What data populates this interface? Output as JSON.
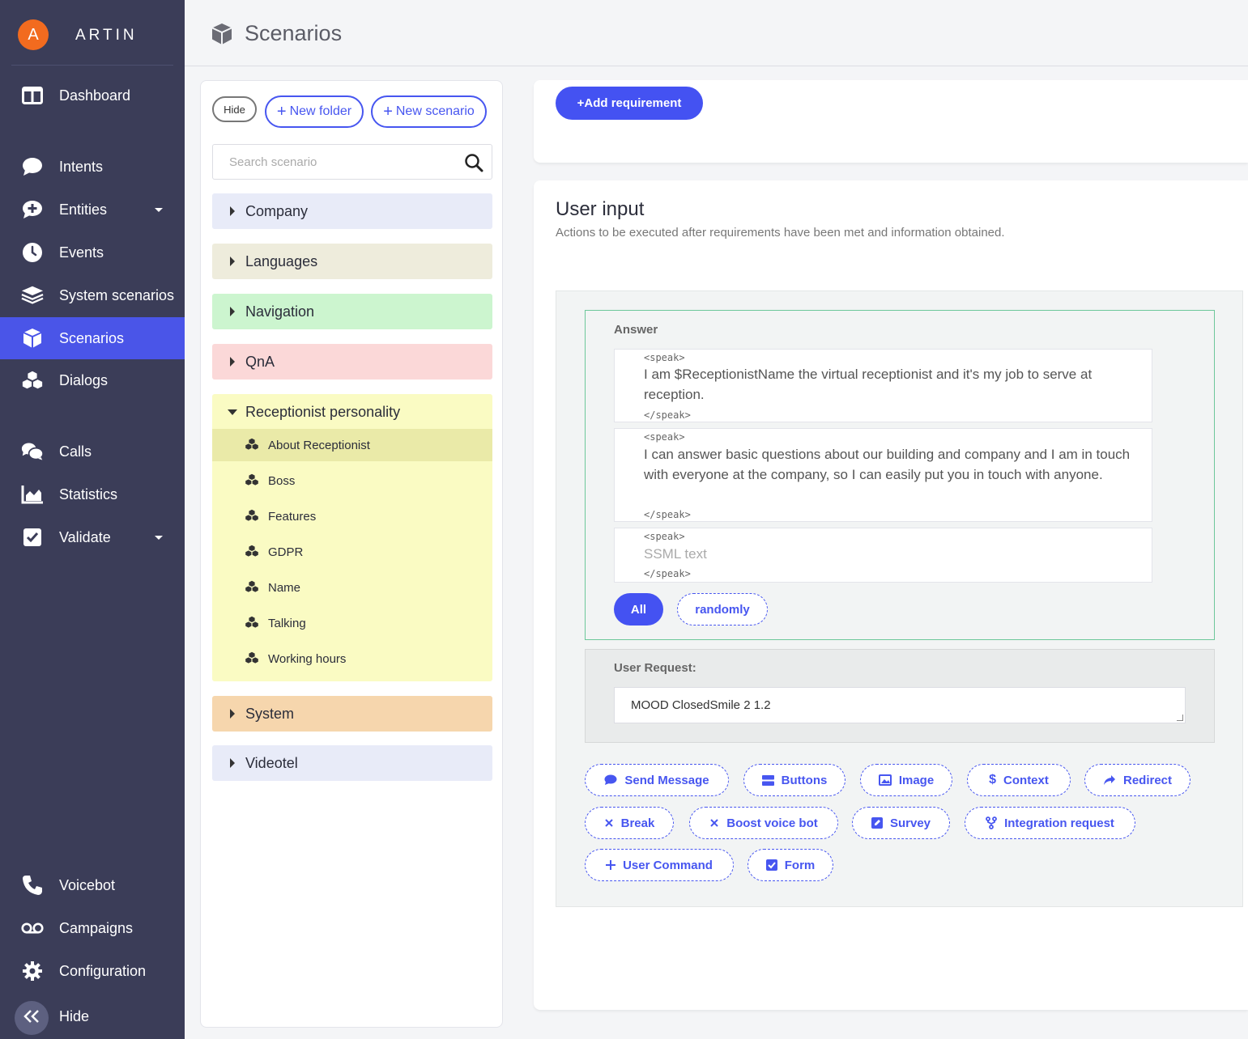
{
  "brand": {
    "avatar_letter": "A",
    "name": "ARTIN"
  },
  "sidebar": {
    "items": [
      {
        "label": "Dashboard",
        "icon": "dashboard-icon"
      },
      {
        "label": "Intents",
        "icon": "chat-bubble-icon"
      },
      {
        "label": "Entities",
        "icon": "chat-plus-icon",
        "has_dropdown": true
      },
      {
        "label": "Events",
        "icon": "clock-icon"
      },
      {
        "label": "System scenarios",
        "icon": "layers-icon"
      },
      {
        "label": "Scenarios",
        "icon": "cube-icon",
        "active": true
      },
      {
        "label": "Dialogs",
        "icon": "cubes-icon"
      },
      {
        "label": "Calls",
        "icon": "comments-icon"
      },
      {
        "label": "Statistics",
        "icon": "area-chart-icon"
      },
      {
        "label": "Validate",
        "icon": "checkbox-icon",
        "has_dropdown": true
      },
      {
        "label": "Voicebot",
        "icon": "phone-icon"
      },
      {
        "label": "Campaigns",
        "icon": "voicemail-icon"
      },
      {
        "label": "Configuration",
        "icon": "gear-icon"
      },
      {
        "label": "Hide",
        "icon": "double-chevron-left-icon"
      }
    ]
  },
  "header": {
    "title": "Scenarios",
    "icon": "cube-icon"
  },
  "tree": {
    "hide_label": "Hide",
    "new_folder_label": "New folder",
    "new_scenario_label": "New scenario",
    "search_placeholder": "Search scenario",
    "folders": [
      {
        "label": "Company",
        "color": "#e8ebf8"
      },
      {
        "label": "Languages",
        "color": "#eeecdc"
      },
      {
        "label": "Navigation",
        "color": "#ccf5cf"
      },
      {
        "label": "QnA",
        "color": "#fbd8d8"
      },
      {
        "label": "Receptionist personality",
        "color": "#fafbc3",
        "expanded": true
      },
      {
        "label": "System",
        "color": "#f6d6ad"
      },
      {
        "label": "Videotel",
        "color": "#e8ebf8"
      }
    ],
    "open_items": [
      "About Receptionist",
      "Boss",
      "Features",
      "GDPR",
      "Name",
      "Talking",
      "Working hours"
    ],
    "selected_item": "About Receptionist"
  },
  "main": {
    "add_requirement_label": "+Add requirement",
    "section_title": "User input",
    "section_desc": "Actions to be executed after requirements have been met and information obtained.",
    "answer": {
      "label": "Answer",
      "open_tag": "<speak>",
      "close_tag": "</speak>",
      "texts": [
        "I am $ReceptionistName the virtual receptionist and it's my job to serve at reception.",
        "I can answer basic questions about our building and company and I am in touch with everyone at the company, so I can easily put you in touch with anyone."
      ],
      "placeholder": "SSML text",
      "mode_all": "All",
      "mode_random": "randomly"
    },
    "user_request": {
      "label": "User Request:",
      "value": "MOOD ClosedSmile 2 1.2"
    },
    "actions": [
      {
        "label": "Send Message",
        "icon": "message-icon"
      },
      {
        "label": "Buttons",
        "icon": "buttons-icon"
      },
      {
        "label": "Image",
        "icon": "image-icon"
      },
      {
        "label": "Context",
        "icon": "dollar-icon"
      },
      {
        "label": "Redirect",
        "icon": "share-icon"
      },
      {
        "label": "Break",
        "icon": "times-icon"
      },
      {
        "label": "Boost voice bot",
        "icon": "times-icon"
      },
      {
        "label": "Survey",
        "icon": "edit-icon"
      },
      {
        "label": "Integration request",
        "icon": "fork-icon"
      },
      {
        "label": "User Command",
        "icon": "plus-icon"
      },
      {
        "label": "Form",
        "icon": "check-square-icon"
      }
    ]
  },
  "colors": {
    "sidebar_bg": "#3b3d58",
    "accent": "#4452f2",
    "active_nav": "#4a55e8",
    "brand_avatar": "#f26b1f"
  }
}
